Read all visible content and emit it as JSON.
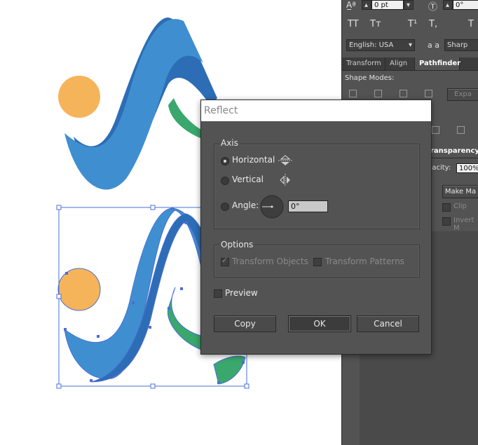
{
  "panel": {
    "leading_value": "0 pt",
    "tracking_value": "0°",
    "language": "English: USA",
    "antialias": "Sharp",
    "aa_label": "a a",
    "tabs": [
      "Transform",
      "Align",
      "Pathfinder"
    ],
    "shape_modes_label": "Shape Modes:",
    "expand_label": "Expa",
    "transparency_tab": "ransparency",
    "opacity_label": "pacity:",
    "opacity_value": "100%",
    "make_mask": "Make Ma",
    "clip_label": "Clip",
    "invert_label": "Invert M",
    "tt_glyphs": [
      "TT",
      "Tт",
      "T¹",
      "T,",
      "T"
    ]
  },
  "dialog": {
    "title": "Reflect",
    "axis_label": "Axis",
    "horizontal_label": "Horizontal",
    "vertical_label": "Vertical",
    "angle_label": "Angle:",
    "angle_value": "0°",
    "options_label": "Options",
    "transform_objects_label": "Transform Objects",
    "transform_patterns_label": "Transform Patterns",
    "preview_label": "Preview",
    "copy_button": "Copy",
    "ok_button": "OK",
    "cancel_button": "Cancel"
  },
  "colors": {
    "blue_light": "#3f8fd0",
    "blue_dark": "#2d6db5",
    "green": "#3aa76d",
    "orange": "#f5b45a",
    "selection": "#4a6fd8"
  }
}
